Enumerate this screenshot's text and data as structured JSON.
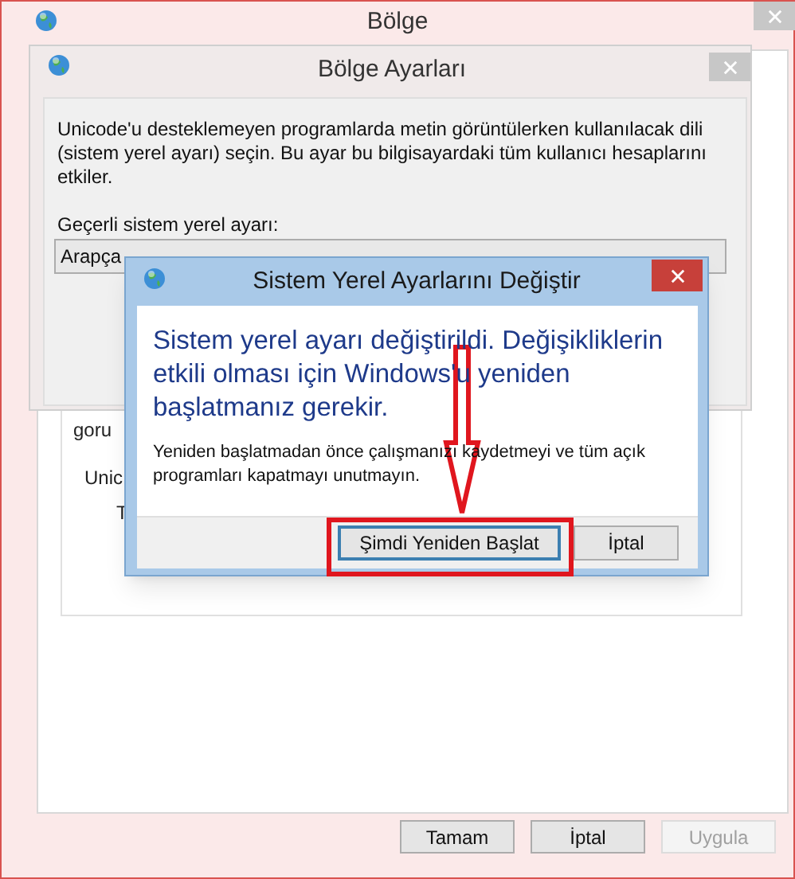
{
  "main_window": {
    "title": "Bölge",
    "background_labels": [
      "goru",
      "Unic",
      "T"
    ],
    "buttons": [
      {
        "label": "Tamam",
        "disabled": false
      },
      {
        "label": "İptal",
        "disabled": false
      },
      {
        "label": "Uygula",
        "disabled": true
      }
    ]
  },
  "settings_dialog": {
    "title": "Bölge Ayarları",
    "description": "Unicode'u desteklemeyen programlarda metin görüntülerken kullanılacak dili (sistem yerel ayarı) seçin. Bu ayar bu bilgisayardaki tüm kullanıcı hesaplarını etkiler.",
    "field_label": "Geçerli sistem yerel ayarı:",
    "locale_dropdown": {
      "value": "Arapça"
    }
  },
  "restart_dialog": {
    "title": "Sistem Yerel Ayarlarını Değiştir",
    "message": "Sistem yerel ayarı değiştirildi. Değişikliklerin etkili olması için Windows'u yeniden başlatmanız gerekir.",
    "note": "Yeniden başlatmadan önce çalışmanızı kaydetmeyi ve tüm açık programları kapatmayı unutmayın.",
    "buttons": [
      {
        "label": "Şimdi Yeniden Başlat",
        "default": true
      },
      {
        "label": "İptal",
        "default": false
      }
    ]
  }
}
